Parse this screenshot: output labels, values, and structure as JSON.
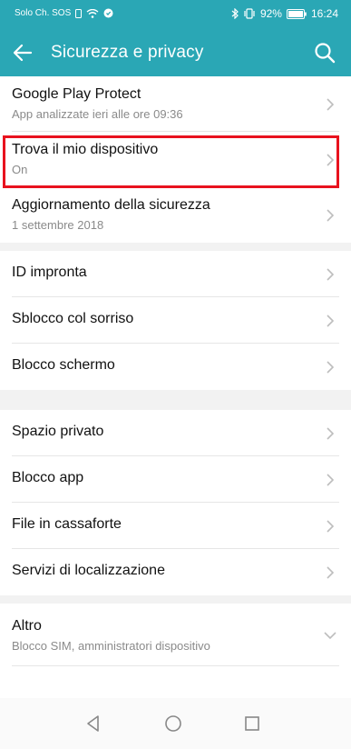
{
  "status": {
    "carrier": "Solo Ch. SOS",
    "battery": "92%",
    "time": "16:24"
  },
  "header": {
    "title": "Sicurezza e privacy"
  },
  "groups": [
    {
      "items": [
        {
          "label": "Google Play Protect",
          "sub": "App analizzate ieri alle ore 09:36"
        },
        {
          "label": "Trova il mio dispositivo",
          "sub": "On"
        },
        {
          "label": "Aggiornamento della sicurezza",
          "sub": "1 settembre 2018"
        }
      ]
    },
    {
      "items": [
        {
          "label": "ID impronta"
        },
        {
          "label": "Sblocco col sorriso"
        },
        {
          "label": "Blocco schermo"
        }
      ]
    },
    {
      "items": [
        {
          "label": "Spazio privato"
        },
        {
          "label": "Blocco app"
        },
        {
          "label": "File in cassaforte"
        },
        {
          "label": "Servizi di localizzazione"
        }
      ]
    },
    {
      "items": [
        {
          "label": "Altro",
          "sub": "Blocco SIM, amministratori dispositivo"
        }
      ]
    }
  ],
  "colors": {
    "accent": "#2aa7b5",
    "highlight": "#e8121e"
  }
}
